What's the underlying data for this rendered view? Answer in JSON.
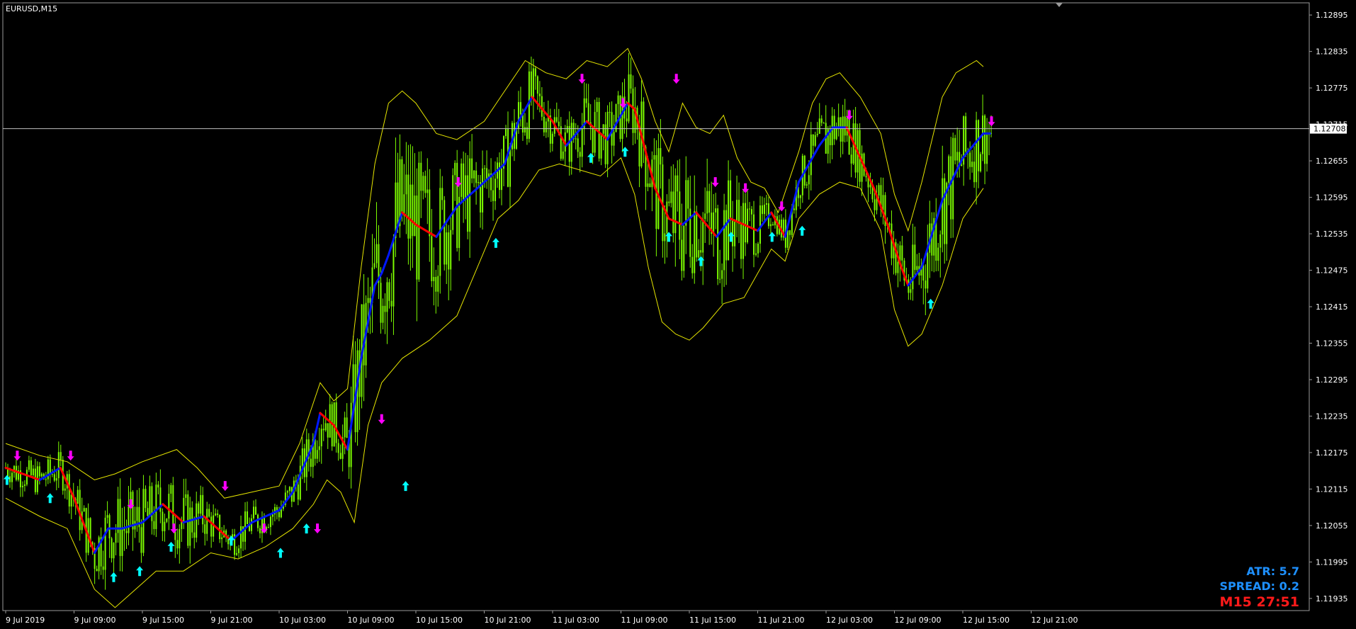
{
  "window": {
    "title": "EURUSD,M15"
  },
  "price_axis": {
    "labels": [
      "1.12895",
      "1.12835",
      "1.12775",
      "1.12715",
      "1.12655",
      "1.12595",
      "1.12535",
      "1.12475",
      "1.12415",
      "1.12355",
      "1.12295",
      "1.12235",
      "1.12175",
      "1.12115",
      "1.12055",
      "1.11995",
      "1.11935"
    ],
    "current_price": "1.12708"
  },
  "time_axis": {
    "labels": [
      "9 Jul 2019",
      "9 Jul 09:00",
      "9 Jul 15:00",
      "9 Jul 21:00",
      "10 Jul 03:00",
      "10 Jul 09:00",
      "10 Jul 15:00",
      "10 Jul 21:00",
      "11 Jul 03:00",
      "11 Jul 09:00",
      "11 Jul 15:00",
      "11 Jul 21:00",
      "12 Jul 03:00",
      "12 Jul 09:00",
      "12 Jul 15:00",
      "12 Jul 21:00"
    ]
  },
  "info_panel": {
    "atr": "ATR: 5.7",
    "spread": "SPREAD: 0.2",
    "timer": "M15 27:51"
  },
  "colors": {
    "background": "#000000",
    "candles": "#7cfc00",
    "bands": "#e6e600",
    "ma_up": "#0018ff",
    "ma_down": "#ff0000",
    "arrow_up": "#00ffff",
    "arrow_down": "#ff00ff",
    "axis_text": "#ffffff",
    "price_line": "#c0c0c0"
  },
  "chart_data": {
    "type": "line",
    "title": "EURUSD,M15",
    "x": [
      "9 Jul 2019",
      "9 Jul 09:00",
      "9 Jul 15:00",
      "9 Jul 21:00",
      "10 Jul 03:00",
      "10 Jul 09:00",
      "10 Jul 15:00",
      "10 Jul 21:00",
      "11 Jul 03:00",
      "11 Jul 09:00",
      "11 Jul 15:00",
      "11 Jul 21:00",
      "12 Jul 03:00",
      "12 Jul 09:00",
      "12 Jul 15:00",
      "12 Jul 21:00"
    ],
    "ylim": [
      1.11915,
      1.12915
    ],
    "series": [
      {
        "role": "ma",
        "points": [
          [
            0,
            1.1215
          ],
          [
            0.5,
            1.1213
          ],
          [
            0.8,
            1.1215
          ],
          [
            1.0,
            1.121
          ],
          [
            1.3,
            1.1201
          ],
          [
            1.5,
            1.1205
          ],
          [
            1.7,
            1.1205
          ],
          [
            2.0,
            1.1206
          ],
          [
            2.3,
            1.1209
          ],
          [
            2.4,
            1.1208
          ],
          [
            2.6,
            1.1206
          ],
          [
            2.9,
            1.1207
          ],
          [
            3.3,
            1.1203
          ],
          [
            3.6,
            1.1206
          ],
          [
            4.0,
            1.1208
          ],
          [
            4.2,
            1.1211
          ],
          [
            4.5,
            1.1219
          ],
          [
            4.6,
            1.1224
          ],
          [
            4.8,
            1.1222
          ],
          [
            5.0,
            1.1218
          ],
          [
            5.2,
            1.1233
          ],
          [
            5.4,
            1.1245
          ],
          [
            5.5,
            1.1247
          ],
          [
            5.6,
            1.125
          ],
          [
            5.8,
            1.1257
          ],
          [
            6.0,
            1.1255
          ],
          [
            6.3,
            1.1253
          ],
          [
            6.6,
            1.1258
          ],
          [
            7.0,
            1.1262
          ],
          [
            7.3,
            1.1265
          ],
          [
            7.5,
            1.1272
          ],
          [
            7.7,
            1.1276
          ],
          [
            8.0,
            1.1272
          ],
          [
            8.2,
            1.1268
          ],
          [
            8.5,
            1.1272
          ],
          [
            8.8,
            1.1269
          ],
          [
            9.1,
            1.1275
          ],
          [
            9.2,
            1.1274
          ],
          [
            9.5,
            1.1261
          ],
          [
            9.7,
            1.1256
          ],
          [
            9.9,
            1.1255
          ],
          [
            10.1,
            1.1257
          ],
          [
            10.4,
            1.1253
          ],
          [
            10.6,
            1.1256
          ],
          [
            10.8,
            1.1255
          ],
          [
            11.0,
            1.1254
          ],
          [
            11.2,
            1.1257
          ],
          [
            11.4,
            1.1253
          ],
          [
            11.6,
            1.1262
          ],
          [
            11.9,
            1.1268
          ],
          [
            12.1,
            1.1271
          ],
          [
            12.3,
            1.1271
          ],
          [
            12.5,
            1.1266
          ],
          [
            12.7,
            1.1261
          ],
          [
            12.9,
            1.1255
          ],
          [
            13.1,
            1.1248
          ],
          [
            13.2,
            1.1245
          ],
          [
            13.4,
            1.1248
          ],
          [
            13.7,
            1.1259
          ],
          [
            14.0,
            1.1266
          ],
          [
            14.3,
            1.127
          ],
          [
            14.4,
            1.127
          ]
        ]
      },
      {
        "role": "upper-band",
        "points": [
          [
            0,
            1.1219
          ],
          [
            0.5,
            1.1217
          ],
          [
            0.9,
            1.1216
          ],
          [
            1.3,
            1.1213
          ],
          [
            1.6,
            1.1214
          ],
          [
            2.0,
            1.1216
          ],
          [
            2.5,
            1.1218
          ],
          [
            2.8,
            1.1215
          ],
          [
            3.2,
            1.121
          ],
          [
            3.6,
            1.1211
          ],
          [
            4.0,
            1.1212
          ],
          [
            4.3,
            1.1219
          ],
          [
            4.6,
            1.1229
          ],
          [
            4.8,
            1.1226
          ],
          [
            5.0,
            1.1228
          ],
          [
            5.2,
            1.1248
          ],
          [
            5.4,
            1.1265
          ],
          [
            5.6,
            1.1275
          ],
          [
            5.8,
            1.1277
          ],
          [
            6.0,
            1.1275
          ],
          [
            6.3,
            1.127
          ],
          [
            6.6,
            1.1269
          ],
          [
            7.0,
            1.1272
          ],
          [
            7.3,
            1.1277
          ],
          [
            7.6,
            1.1282
          ],
          [
            7.9,
            1.128
          ],
          [
            8.2,
            1.1279
          ],
          [
            8.5,
            1.1282
          ],
          [
            8.8,
            1.1281
          ],
          [
            9.1,
            1.1284
          ],
          [
            9.3,
            1.1279
          ],
          [
            9.5,
            1.1272
          ],
          [
            9.7,
            1.1267
          ],
          [
            9.9,
            1.1275
          ],
          [
            10.1,
            1.1271
          ],
          [
            10.3,
            1.127
          ],
          [
            10.5,
            1.1273
          ],
          [
            10.7,
            1.1266
          ],
          [
            10.9,
            1.1262
          ],
          [
            11.1,
            1.1261
          ],
          [
            11.3,
            1.1257
          ],
          [
            11.6,
            1.1267
          ],
          [
            11.8,
            1.1275
          ],
          [
            12.0,
            1.1279
          ],
          [
            12.2,
            1.128
          ],
          [
            12.5,
            1.1276
          ],
          [
            12.8,
            1.127
          ],
          [
            13.0,
            1.126
          ],
          [
            13.2,
            1.1254
          ],
          [
            13.4,
            1.1262
          ],
          [
            13.7,
            1.1276
          ],
          [
            13.9,
            1.128
          ],
          [
            14.2,
            1.1282
          ],
          [
            14.3,
            1.1281
          ]
        ]
      },
      {
        "role": "lower-band",
        "points": [
          [
            0,
            1.121
          ],
          [
            0.5,
            1.1207
          ],
          [
            0.9,
            1.1205
          ],
          [
            1.3,
            1.1195
          ],
          [
            1.6,
            1.1192
          ],
          [
            1.8,
            1.1194
          ],
          [
            2.2,
            1.1198
          ],
          [
            2.6,
            1.1198
          ],
          [
            3.0,
            1.1201
          ],
          [
            3.4,
            1.12
          ],
          [
            3.8,
            1.1202
          ],
          [
            4.2,
            1.1205
          ],
          [
            4.5,
            1.1209
          ],
          [
            4.7,
            1.1213
          ],
          [
            4.9,
            1.1211
          ],
          [
            5.1,
            1.1206
          ],
          [
            5.3,
            1.1222
          ],
          [
            5.5,
            1.1229
          ],
          [
            5.8,
            1.1233
          ],
          [
            6.2,
            1.1236
          ],
          [
            6.6,
            1.124
          ],
          [
            6.9,
            1.1248
          ],
          [
            7.2,
            1.1256
          ],
          [
            7.5,
            1.1259
          ],
          [
            7.8,
            1.1264
          ],
          [
            8.1,
            1.1265
          ],
          [
            8.4,
            1.1264
          ],
          [
            8.7,
            1.1263
          ],
          [
            9.0,
            1.1266
          ],
          [
            9.2,
            1.126
          ],
          [
            9.4,
            1.1248
          ],
          [
            9.6,
            1.1239
          ],
          [
            9.8,
            1.1237
          ],
          [
            10.0,
            1.1236
          ],
          [
            10.2,
            1.1238
          ],
          [
            10.5,
            1.1242
          ],
          [
            10.8,
            1.1243
          ],
          [
            11.0,
            1.1247
          ],
          [
            11.2,
            1.1251
          ],
          [
            11.4,
            1.1249
          ],
          [
            11.6,
            1.1256
          ],
          [
            11.9,
            1.126
          ],
          [
            12.2,
            1.1262
          ],
          [
            12.5,
            1.1261
          ],
          [
            12.8,
            1.1254
          ],
          [
            13.0,
            1.1241
          ],
          [
            13.2,
            1.1235
          ],
          [
            13.4,
            1.1237
          ],
          [
            13.7,
            1.1245
          ],
          [
            14.0,
            1.1256
          ],
          [
            14.3,
            1.1261
          ]
        ]
      }
    ],
    "signals": {
      "up": [
        [
          0.02,
          1.1213
        ],
        [
          0.65,
          1.121
        ],
        [
          1.58,
          1.1197
        ],
        [
          1.96,
          1.1198
        ],
        [
          2.42,
          1.1202
        ],
        [
          3.3,
          1.1203
        ],
        [
          4.02,
          1.1201
        ],
        [
          4.4,
          1.1205
        ],
        [
          5.85,
          1.1212
        ],
        [
          7.17,
          1.1252
        ],
        [
          8.56,
          1.1266
        ],
        [
          9.06,
          1.1267
        ],
        [
          9.7,
          1.1253
        ],
        [
          10.17,
          1.1249
        ],
        [
          10.61,
          1.1253
        ],
        [
          11.21,
          1.1253
        ],
        [
          11.65,
          1.1254
        ],
        [
          13.53,
          1.1242
        ]
      ],
      "down": [
        [
          0.17,
          1.1217
        ],
        [
          0.95,
          1.1217
        ],
        [
          1.83,
          1.1209
        ],
        [
          2.46,
          1.1205
        ],
        [
          3.21,
          1.1212
        ],
        [
          3.78,
          1.1205
        ],
        [
          4.56,
          1.1205
        ],
        [
          5.5,
          1.1223
        ],
        [
          6.62,
          1.1262
        ],
        [
          8.43,
          1.1279
        ],
        [
          9.03,
          1.1275
        ],
        [
          9.81,
          1.1279
        ],
        [
          10.38,
          1.1262
        ],
        [
          10.82,
          1.1261
        ],
        [
          11.35,
          1.1258
        ],
        [
          12.34,
          1.1273
        ],
        [
          14.42,
          1.1272
        ]
      ]
    }
  }
}
